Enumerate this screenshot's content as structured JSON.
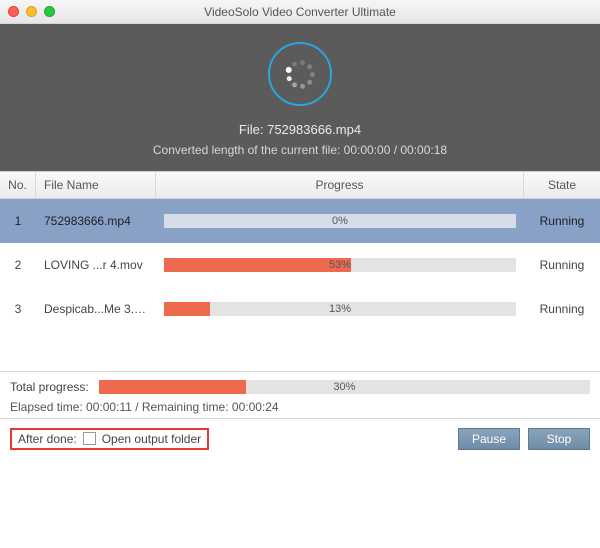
{
  "window": {
    "title": "VideoSolo Video Converter Ultimate"
  },
  "hero": {
    "file_label": "File: 752983666.mp4",
    "converted_label": "Converted length of the current file: 00:00:00 / 00:00:18"
  },
  "columns": {
    "no": "No.",
    "name": "File Name",
    "progress": "Progress",
    "state": "State"
  },
  "rows": [
    {
      "no": "1",
      "name": "752983666.mp4",
      "pct": "0%",
      "fill": 0,
      "state": "Running",
      "selected": true
    },
    {
      "no": "2",
      "name": "LOVING ...r 4.mov",
      "pct": "53%",
      "fill": 53,
      "state": "Running",
      "selected": false
    },
    {
      "no": "3",
      "name": "Despicab...Me 3.avi",
      "pct": "13%",
      "fill": 13,
      "state": "Running",
      "selected": false
    }
  ],
  "total": {
    "label": "Total progress:",
    "pct": "30%",
    "fill": 30
  },
  "elapsed": "Elapsed time: 00:00:11 / Remaining time: 00:00:24",
  "after": {
    "label": "After done:",
    "checkbox_label": "Open output folder"
  },
  "buttons": {
    "pause": "Pause",
    "stop": "Stop"
  },
  "colors": {
    "accent": "#ee6a4f",
    "ring": "#2aa6e0",
    "highlight": "#e63b2e"
  }
}
